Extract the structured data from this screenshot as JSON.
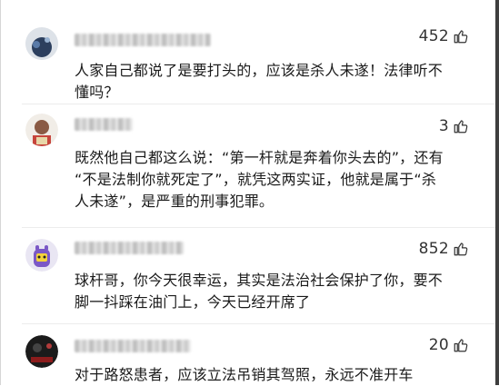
{
  "comments": [
    {
      "likes": "452",
      "text": "人家自己都说了是要打头的，应该是杀人未遂！法律听不\n懂吗？"
    },
    {
      "likes": "3",
      "text": "既然他自己都这么说：“第一杆就是奔着你头去的”，还有\n“不是法制你就死定了”，就凭这两实证，他就是属于“杀\n人未遂”，是严重的刑事犯罪。"
    },
    {
      "likes": "852",
      "text": "球杆哥，你今天很幸运，其实是法治社会保护了你，要不\n脚一抖踩在油门上，今天已经开席了"
    },
    {
      "likes": "20",
      "text": "对于路怒患者，应该立法吊销其驾照，永远不准开车"
    }
  ],
  "icons": {
    "like": "thumbs-up-outline-icon"
  }
}
